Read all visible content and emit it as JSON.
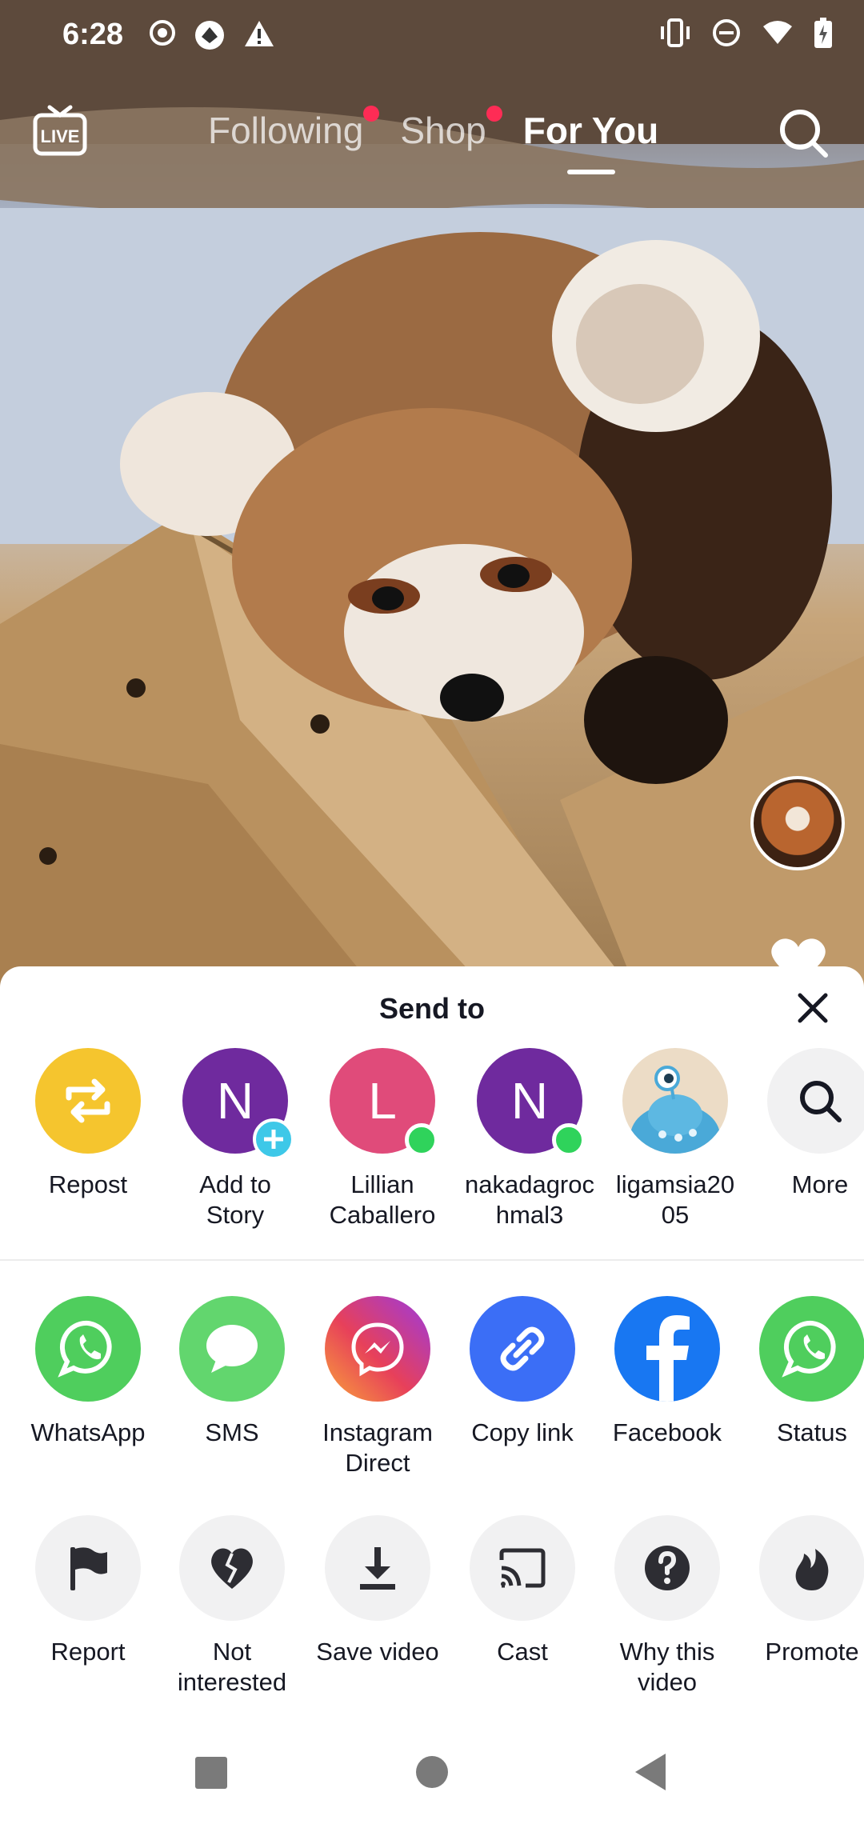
{
  "status_bar": {
    "time": "6:28",
    "left_icons": [
      "record-icon",
      "vpn-icon",
      "alert-icon"
    ],
    "right_icons": [
      "vibrate-icon",
      "dnd-icon",
      "wifi-icon",
      "battery-icon"
    ]
  },
  "top_nav": {
    "live_label": "LIVE",
    "tabs": [
      {
        "label": "Following",
        "notification_dot": true
      },
      {
        "label": "Shop",
        "notification_dot": true
      },
      {
        "label": "For You",
        "active": true
      }
    ]
  },
  "share_sheet": {
    "title": "Send to",
    "contacts": [
      {
        "label": "Repost",
        "icon": "repost-icon",
        "color": "#f5c52e"
      },
      {
        "label": "Add to\nStory",
        "letter": "N",
        "color": "#6f2a9e",
        "badge": "add"
      },
      {
        "label": "Lillian\nCaballero",
        "letter": "L",
        "color": "#e04b7a",
        "badge": "online"
      },
      {
        "label": "nakadagroc\nhmal3",
        "letter": "N",
        "color": "#6f2a9e",
        "badge": "online"
      },
      {
        "label": "ligamsia20\n05",
        "icon": "monster-avatar",
        "color": "#ecdcc6"
      },
      {
        "label": "More",
        "icon": "search-icon",
        "color": "#f1f1f2"
      }
    ],
    "apps": [
      {
        "label": "WhatsApp",
        "icon": "whatsapp-icon",
        "color": "#4fce5d"
      },
      {
        "label": "SMS",
        "icon": "sms-icon",
        "color": "#62d66e"
      },
      {
        "label": "Instagram\nDirect",
        "icon": "messenger-icon",
        "color": "#c13584"
      },
      {
        "label": "Copy link",
        "icon": "link-icon",
        "color": "#3b6ef6"
      },
      {
        "label": "Facebook",
        "icon": "facebook-icon",
        "color": "#1877f2"
      },
      {
        "label": "Status",
        "icon": "whatsapp-icon",
        "color": "#4fce5d"
      }
    ],
    "actions": [
      {
        "label": "Report",
        "icon": "flag-icon"
      },
      {
        "label": "Not\ninterested",
        "icon": "broken-heart-icon"
      },
      {
        "label": "Save video",
        "icon": "download-icon"
      },
      {
        "label": "Cast",
        "icon": "cast-icon"
      },
      {
        "label": "Why this\nvideo",
        "icon": "question-icon"
      },
      {
        "label": "Promote",
        "icon": "flame-icon"
      }
    ]
  },
  "nav_bar": {
    "buttons": [
      "recents-icon",
      "home-icon",
      "back-icon"
    ]
  }
}
